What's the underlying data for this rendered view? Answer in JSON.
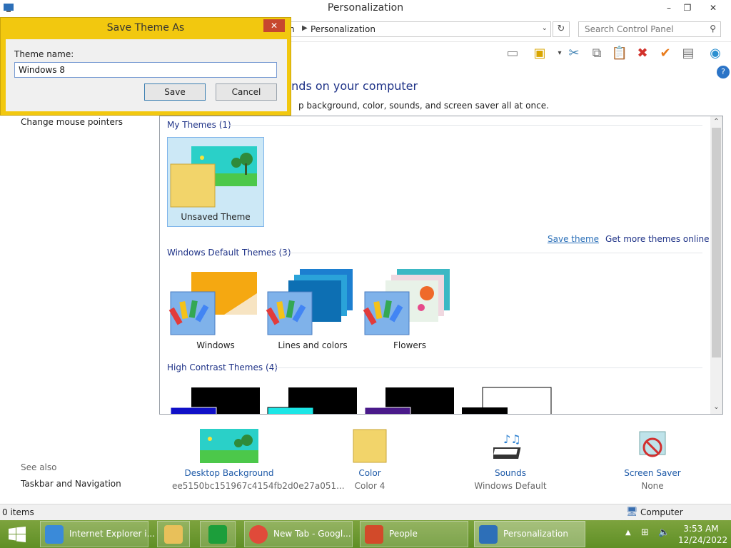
{
  "window": {
    "title": "Personalization",
    "controls": {
      "min": "–",
      "max": "❐",
      "close": "✕"
    }
  },
  "address": {
    "prefix": "n",
    "crumb": "Personalization"
  },
  "search": {
    "placeholder": "Search Control Panel"
  },
  "main": {
    "heading": "unds on your computer",
    "subheading": "p background, color, sounds, and screen saver all at once."
  },
  "sidebar": {
    "links": [
      "Change mouse pointers"
    ],
    "see_also_label": "See also",
    "see_also_links": [
      "Taskbar and Navigation"
    ]
  },
  "themes": {
    "my_themes_header": "My Themes (1)",
    "my_themes": [
      {
        "label": "Unsaved Theme"
      }
    ],
    "save_theme": "Save theme",
    "get_more": "Get more themes online",
    "default_header": "Windows Default Themes (3)",
    "default_themes": [
      {
        "label": "Windows"
      },
      {
        "label": "Lines and colors"
      },
      {
        "label": "Flowers"
      }
    ],
    "high_contrast_header": "High Contrast Themes (4)"
  },
  "bottom": {
    "desktop_background": {
      "title": "Desktop Background",
      "sub": "ee5150bc151967c4154fb2d0e27a051..."
    },
    "color": {
      "title": "Color",
      "sub": "Color 4"
    },
    "sounds": {
      "title": "Sounds",
      "sub": "Windows Default"
    },
    "screen_saver": {
      "title": "Screen Saver",
      "sub": "None"
    }
  },
  "status": {
    "items": "0 items",
    "location": "Computer"
  },
  "dialog": {
    "title": "Save Theme As",
    "close": "✕",
    "field_label": "Theme name:",
    "field_value": "Windows 8",
    "save": "Save",
    "cancel": "Cancel"
  },
  "taskbar": {
    "apps": [
      "Internet Explorer i...",
      "New Tab - Googl...",
      "People",
      "Personalization"
    ],
    "time": "3:53 AM",
    "date": "12/24/2022"
  },
  "colors": {
    "accent": "#f2c80f",
    "link": "#1e3287",
    "taskbar": "#6a9a2d"
  }
}
